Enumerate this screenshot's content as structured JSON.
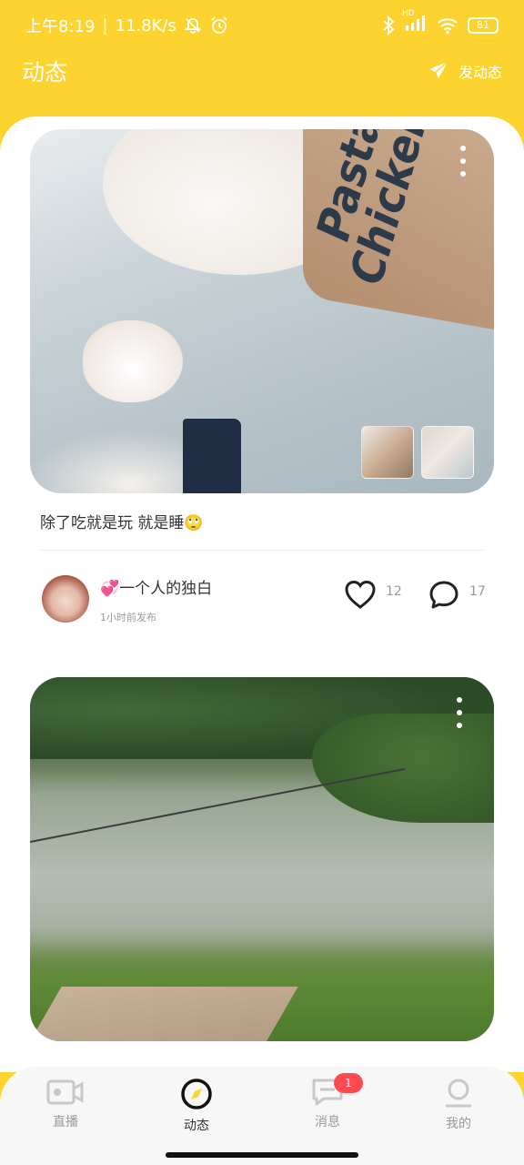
{
  "status_bar": {
    "time": "上午8:19",
    "net_speed": "11.8K/s",
    "hd_label": "HD",
    "battery": "81"
  },
  "header": {
    "title": "动态",
    "post_button_label": "发动态"
  },
  "posts": [
    {
      "image_text": "Pasta Chicken",
      "caption": "除了吃就是玩 就是睡🙄",
      "author": "💞一个人的独白",
      "time": "1小时前发布",
      "likes": "12",
      "comments": "17"
    },
    {
      "image_subject": "river landscape"
    }
  ],
  "tabbar": {
    "items": [
      {
        "label": "直播",
        "icon": "live-camera-icon"
      },
      {
        "label": "动态",
        "icon": "compass-icon"
      },
      {
        "label": "消息",
        "icon": "message-icon",
        "badge": "1"
      },
      {
        "label": "我的",
        "icon": "profile-icon"
      }
    ],
    "active": "动态"
  },
  "colors": {
    "brand_yellow": "#fdd42f",
    "badge_red": "#ff4a52",
    "text_dark": "#333333",
    "text_muted": "#999999"
  }
}
